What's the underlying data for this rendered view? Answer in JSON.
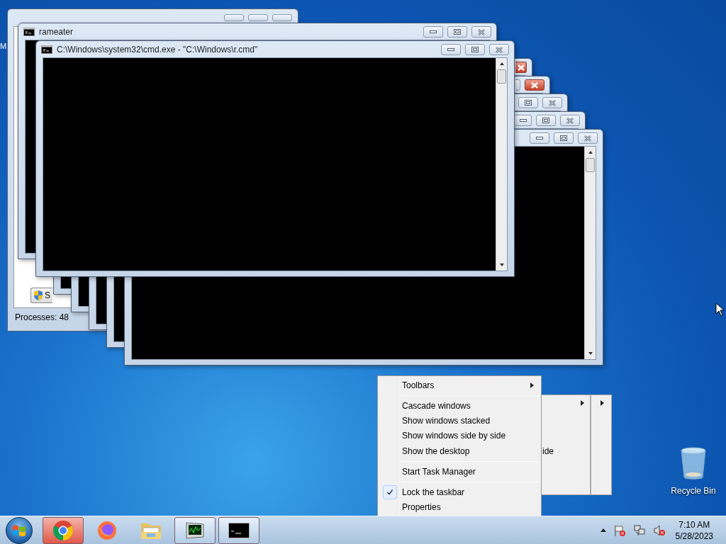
{
  "desktop": {
    "partial_icon_label": "M",
    "recycle_bin_label": "Recycle Bin"
  },
  "task_manager": {
    "button_label": "S",
    "status": "Processes: 48"
  },
  "rameater_window": {
    "title": "rameater"
  },
  "stacked_windows": [
    {
      "close_hover": true
    },
    {
      "close_hover": true
    },
    {
      "close_hover": false
    },
    {
      "close_hover": false
    },
    {
      "close_hover": false
    }
  ],
  "main_window": {
    "title": "C:\\Windows\\system32\\cmd.exe - \"C:\\Windows\\r.cmd\""
  },
  "context_menu": {
    "items": [
      {
        "kind": "submenu",
        "label": "Toolbars",
        "checked": false
      },
      {
        "kind": "separator"
      },
      {
        "kind": "item",
        "label": "Cascade windows",
        "checked": false
      },
      {
        "kind": "item",
        "label": "Show windows stacked",
        "checked": false
      },
      {
        "kind": "item",
        "label": "Show windows side by side",
        "checked": false
      },
      {
        "kind": "item",
        "label": "Show the desktop",
        "checked": false
      },
      {
        "kind": "separator"
      },
      {
        "kind": "item",
        "label": "Start Task Manager",
        "checked": false
      },
      {
        "kind": "separator"
      },
      {
        "kind": "item",
        "label": "Lock the taskbar",
        "checked": true
      },
      {
        "kind": "item",
        "label": "Properties",
        "checked": false
      }
    ]
  },
  "ghost_menu": {
    "partial_label": "ide"
  },
  "taskbar": {
    "buttons": [
      {
        "kind": "chrome",
        "flashing": true,
        "running": true
      },
      {
        "kind": "firefox",
        "flashing": false,
        "running": false
      },
      {
        "kind": "explorer",
        "flashing": false,
        "running": false
      },
      {
        "kind": "task_manager",
        "flashing": false,
        "running": true
      },
      {
        "kind": "console",
        "flashing": false,
        "running": true
      }
    ],
    "time": "7:10 AM",
    "date": "5/28/2023"
  }
}
